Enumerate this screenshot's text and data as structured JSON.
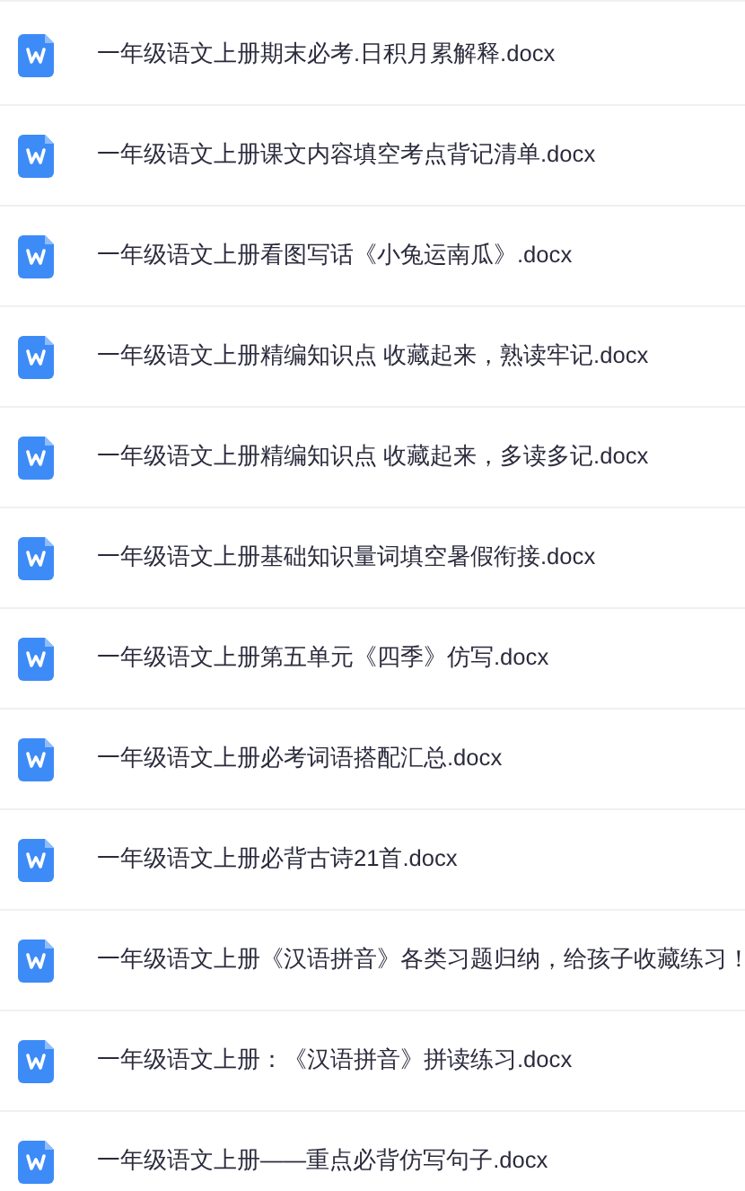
{
  "files": [
    {
      "name": "一年级语文上册期末必考.日积月累解释.docx"
    },
    {
      "name": "一年级语文上册课文内容填空考点背记清单.docx"
    },
    {
      "name": "一年级语文上册看图写话《小兔运南瓜》.docx"
    },
    {
      "name": "一年级语文上册精编知识点 收藏起来，熟读牢记.docx"
    },
    {
      "name": "一年级语文上册精编知识点 收藏起来，多读多记.docx"
    },
    {
      "name": "一年级语文上册基础知识量词填空暑假衔接.docx"
    },
    {
      "name": "一年级语文上册第五单元《四季》仿写.docx"
    },
    {
      "name": "一年级语文上册必考词语搭配汇总.docx"
    },
    {
      "name": "一年级语文上册必背古诗21首.docx"
    },
    {
      "name": "一年级语文上册《汉语拼音》各类习题归纳，给孩子收藏练习！"
    },
    {
      "name": "一年级语文上册：《汉语拼音》拼读练习.docx"
    },
    {
      "name": "一年级语文上册——重点必背仿写句子.docx"
    }
  ]
}
